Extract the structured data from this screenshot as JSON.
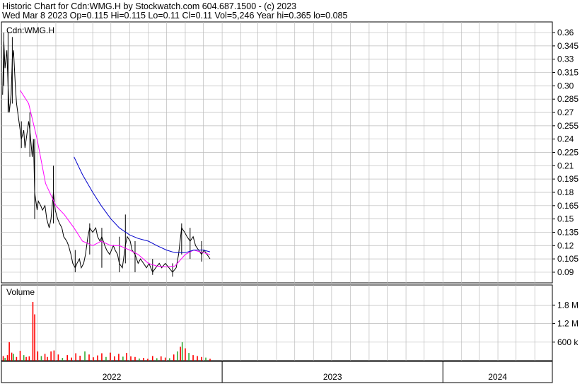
{
  "header": {
    "line1": "Historic Chart for Cdn:WMG.H by Stockwatch.com 604.687.1500 - (c) 2023",
    "line2": "Wed Mar  8 2023   Op=0.115   Hi=0.115   Lo=0.11   Cl=0.11   Vol=5,246   Year hi=0.365   lo=0.085"
  },
  "chart_data": {
    "type": "line",
    "symbol_label": "Cdn:WMG.H",
    "volume_label": "Volume",
    "price_ticks": [
      "0.36",
      "0.345",
      "0.33",
      "0.315",
      "0.30",
      "0.285",
      "0.27",
      "0.255",
      "0.24",
      "0.225",
      "0.21",
      "0.195",
      "0.18",
      "0.165",
      "0.15",
      "0.135",
      "0.12",
      "0.105",
      "0.09"
    ],
    "price_tick_values": [
      0.36,
      0.345,
      0.33,
      0.315,
      0.3,
      0.285,
      0.27,
      0.255,
      0.24,
      0.225,
      0.21,
      0.195,
      0.18,
      0.165,
      0.15,
      0.135,
      0.12,
      0.105,
      0.09
    ],
    "price_ylim": [
      0.078,
      0.372
    ],
    "volume_ticks": [
      "1.8 M",
      "1.2 M",
      "600 k"
    ],
    "volume_tick_values": [
      1800000,
      1200000,
      600000
    ],
    "volume_ylim": [
      0,
      2450000
    ],
    "x_labels": [
      "2022",
      "2023",
      "2024"
    ],
    "x_range": [
      "2022-01-01",
      "2024-06-30"
    ],
    "x_year_boundaries": [
      "2023-01-01",
      "2024-01-01"
    ],
    "grid": true,
    "colors": {
      "price": "#000000",
      "ma_fast": "#ff00ff",
      "ma_slow": "#0000cc",
      "vol_down": "#ff0000",
      "vol_up": "#33aa33",
      "grid": "#bbbbbb"
    },
    "price_path": [
      [
        "2022-01-03",
        0.29
      ],
      [
        "2022-01-05",
        0.35
      ],
      [
        "2022-01-07",
        0.32
      ],
      [
        "2022-01-10",
        0.34
      ],
      [
        "2022-01-12",
        0.3
      ],
      [
        "2022-01-14",
        0.27
      ],
      [
        "2022-01-17",
        0.29
      ],
      [
        "2022-01-19",
        0.33
      ],
      [
        "2022-01-21",
        0.34
      ],
      [
        "2022-01-24",
        0.3
      ],
      [
        "2022-01-26",
        0.28
      ],
      [
        "2022-01-28",
        0.27
      ],
      [
        "2022-02-01",
        0.25
      ],
      [
        "2022-02-03",
        0.24
      ],
      [
        "2022-02-07",
        0.25
      ],
      [
        "2022-02-09",
        0.23
      ],
      [
        "2022-02-11",
        0.24
      ],
      [
        "2022-02-15",
        0.26
      ],
      [
        "2022-02-17",
        0.25
      ],
      [
        "2022-02-21",
        0.22
      ],
      [
        "2022-02-23",
        0.24
      ],
      [
        "2022-02-25",
        0.18
      ],
      [
        "2022-03-01",
        0.16
      ],
      [
        "2022-03-03",
        0.17
      ],
      [
        "2022-03-07",
        0.165
      ],
      [
        "2022-03-10",
        0.16
      ],
      [
        "2022-03-14",
        0.165
      ],
      [
        "2022-03-17",
        0.15
      ],
      [
        "2022-03-21",
        0.14
      ],
      [
        "2022-03-24",
        0.15
      ],
      [
        "2022-03-28",
        0.18
      ],
      [
        "2022-03-31",
        0.16
      ],
      [
        "2022-04-04",
        0.15
      ],
      [
        "2022-04-07",
        0.145
      ],
      [
        "2022-04-11",
        0.14
      ],
      [
        "2022-04-14",
        0.13
      ],
      [
        "2022-04-19",
        0.125
      ],
      [
        "2022-04-22",
        0.12
      ],
      [
        "2022-04-26",
        0.11
      ],
      [
        "2022-04-29",
        0.1
      ],
      [
        "2022-05-03",
        0.095
      ],
      [
        "2022-05-06",
        0.1
      ],
      [
        "2022-05-10",
        0.105
      ],
      [
        "2022-05-13",
        0.095
      ],
      [
        "2022-05-17",
        0.1
      ],
      [
        "2022-05-20",
        0.11
      ],
      [
        "2022-05-24",
        0.13
      ],
      [
        "2022-05-27",
        0.14
      ],
      [
        "2022-06-01",
        0.135
      ],
      [
        "2022-06-06",
        0.14
      ],
      [
        "2022-06-09",
        0.13
      ],
      [
        "2022-06-13",
        0.125
      ],
      [
        "2022-06-16",
        0.13
      ],
      [
        "2022-06-21",
        0.12
      ],
      [
        "2022-06-24",
        0.115
      ],
      [
        "2022-06-29",
        0.11
      ],
      [
        "2022-07-05",
        0.12
      ],
      [
        "2022-07-08",
        0.115
      ],
      [
        "2022-07-12",
        0.11
      ],
      [
        "2022-07-15",
        0.1
      ],
      [
        "2022-07-20",
        0.095
      ],
      [
        "2022-07-25",
        0.12
      ],
      [
        "2022-07-28",
        0.13
      ],
      [
        "2022-08-02",
        0.125
      ],
      [
        "2022-08-05",
        0.115
      ],
      [
        "2022-08-10",
        0.11
      ],
      [
        "2022-08-15",
        0.1
      ],
      [
        "2022-08-19",
        0.105
      ],
      [
        "2022-08-24",
        0.1
      ],
      [
        "2022-08-29",
        0.095
      ],
      [
        "2022-09-02",
        0.1
      ],
      [
        "2022-09-08",
        0.09
      ],
      [
        "2022-09-13",
        0.095
      ],
      [
        "2022-09-19",
        0.1
      ],
      [
        "2022-09-23",
        0.095
      ],
      [
        "2022-09-29",
        0.1
      ],
      [
        "2022-10-05",
        0.095
      ],
      [
        "2022-10-11",
        0.09
      ],
      [
        "2022-10-17",
        0.095
      ],
      [
        "2022-10-21",
        0.11
      ],
      [
        "2022-10-26",
        0.14
      ],
      [
        "2022-10-31",
        0.135
      ],
      [
        "2022-11-04",
        0.13
      ],
      [
        "2022-11-09",
        0.125
      ],
      [
        "2022-11-14",
        0.13
      ],
      [
        "2022-11-18",
        0.12
      ],
      [
        "2022-11-23",
        0.115
      ],
      [
        "2022-11-28",
        0.11
      ],
      [
        "2022-12-02",
        0.115
      ],
      [
        "2022-12-07",
        0.11
      ],
      [
        "2022-12-12",
        0.105
      ]
    ],
    "price_bars": [
      [
        "2022-01-05",
        0.3,
        0.36
      ],
      [
        "2022-01-12",
        0.27,
        0.36
      ],
      [
        "2022-01-19",
        0.28,
        0.355
      ],
      [
        "2022-02-03",
        0.23,
        0.26
      ],
      [
        "2022-02-17",
        0.22,
        0.27
      ],
      [
        "2022-02-25",
        0.15,
        0.24
      ],
      [
        "2022-03-28",
        0.145,
        0.21
      ],
      [
        "2022-05-03",
        0.09,
        0.115
      ],
      [
        "2022-05-27",
        0.11,
        0.145
      ],
      [
        "2022-06-16",
        0.095,
        0.14
      ],
      [
        "2022-07-15",
        0.09,
        0.13
      ],
      [
        "2022-07-25",
        0.1,
        0.155
      ],
      [
        "2022-08-10",
        0.09,
        0.125
      ],
      [
        "2022-09-08",
        0.087,
        0.105
      ],
      [
        "2022-10-11",
        0.085,
        0.1
      ],
      [
        "2022-10-26",
        0.11,
        0.145
      ],
      [
        "2022-11-09",
        0.105,
        0.14
      ],
      [
        "2022-11-28",
        0.102,
        0.125
      ]
    ],
    "series": [
      {
        "values": [
          [
            "2022-02-01",
            0.295
          ],
          [
            "2022-02-15",
            0.28
          ],
          [
            "2022-03-01",
            0.24
          ],
          [
            "2022-03-15",
            0.19
          ],
          [
            "2022-04-01",
            0.165
          ],
          [
            "2022-04-15",
            0.155
          ],
          [
            "2022-05-01",
            0.14
          ],
          [
            "2022-05-15",
            0.125
          ],
          [
            "2022-06-01",
            0.12
          ],
          [
            "2022-06-15",
            0.125
          ],
          [
            "2022-07-01",
            0.12
          ],
          [
            "2022-07-15",
            0.12
          ],
          [
            "2022-08-01",
            0.115
          ],
          [
            "2022-08-15",
            0.11
          ],
          [
            "2022-09-01",
            0.1
          ],
          [
            "2022-09-15",
            0.097
          ],
          [
            "2022-10-01",
            0.096
          ],
          [
            "2022-10-15",
            0.097
          ],
          [
            "2022-11-01",
            0.11
          ],
          [
            "2022-11-15",
            0.115
          ],
          [
            "2022-12-01",
            0.112
          ],
          [
            "2022-12-12",
            0.11
          ]
        ]
      },
      {
        "values": [
          [
            "2022-05-01",
            0.22
          ],
          [
            "2022-05-15",
            0.2
          ],
          [
            "2022-06-01",
            0.18
          ],
          [
            "2022-06-15",
            0.165
          ],
          [
            "2022-07-01",
            0.15
          ],
          [
            "2022-07-15",
            0.14
          ],
          [
            "2022-08-01",
            0.132
          ],
          [
            "2022-08-15",
            0.128
          ],
          [
            "2022-09-01",
            0.125
          ],
          [
            "2022-09-15",
            0.12
          ],
          [
            "2022-10-01",
            0.115
          ],
          [
            "2022-10-15",
            0.112
          ],
          [
            "2022-11-01",
            0.112
          ],
          [
            "2022-11-15",
            0.115
          ],
          [
            "2022-12-01",
            0.115
          ],
          [
            "2022-12-12",
            0.113
          ]
        ]
      }
    ],
    "volume": [
      [
        "2022-01-04",
        150000,
        "down"
      ],
      [
        "2022-01-07",
        90000,
        "up"
      ],
      [
        "2022-01-11",
        180000,
        "down"
      ],
      [
        "2022-01-14",
        600000,
        "down"
      ],
      [
        "2022-01-18",
        260000,
        "down"
      ],
      [
        "2022-01-21",
        220000,
        "up"
      ],
      [
        "2022-01-26",
        120000,
        "down"
      ],
      [
        "2022-02-01",
        320000,
        "down"
      ],
      [
        "2022-02-07",
        180000,
        "up"
      ],
      [
        "2022-02-11",
        120000,
        "down"
      ],
      [
        "2022-02-16",
        140000,
        "down"
      ],
      [
        "2022-02-22",
        1900000,
        "down"
      ],
      [
        "2022-02-25",
        1500000,
        "down"
      ],
      [
        "2022-03-02",
        300000,
        "down"
      ],
      [
        "2022-03-08",
        150000,
        "up"
      ],
      [
        "2022-03-14",
        220000,
        "down"
      ],
      [
        "2022-03-18",
        120000,
        "down"
      ],
      [
        "2022-03-24",
        300000,
        "down"
      ],
      [
        "2022-03-29",
        330000,
        "down"
      ],
      [
        "2022-04-05",
        200000,
        "down"
      ],
      [
        "2022-04-12",
        90000,
        "up"
      ],
      [
        "2022-04-20",
        180000,
        "down"
      ],
      [
        "2022-04-27",
        100000,
        "down"
      ],
      [
        "2022-05-04",
        240000,
        "down"
      ],
      [
        "2022-05-11",
        160000,
        "down"
      ],
      [
        "2022-05-19",
        300000,
        "up"
      ],
      [
        "2022-05-26",
        200000,
        "down"
      ],
      [
        "2022-06-02",
        110000,
        "down"
      ],
      [
        "2022-06-09",
        170000,
        "down"
      ],
      [
        "2022-06-16",
        240000,
        "down"
      ],
      [
        "2022-06-23",
        120000,
        "up"
      ],
      [
        "2022-06-30",
        260000,
        "down"
      ],
      [
        "2022-07-07",
        140000,
        "down"
      ],
      [
        "2022-07-14",
        220000,
        "down"
      ],
      [
        "2022-07-21",
        130000,
        "up"
      ],
      [
        "2022-07-27",
        250000,
        "down"
      ],
      [
        "2022-08-03",
        140000,
        "down"
      ],
      [
        "2022-08-10",
        120000,
        "down"
      ],
      [
        "2022-08-17",
        70000,
        "up"
      ],
      [
        "2022-08-24",
        90000,
        "down"
      ],
      [
        "2022-08-31",
        60000,
        "down"
      ],
      [
        "2022-09-08",
        150000,
        "down"
      ],
      [
        "2022-09-15",
        80000,
        "up"
      ],
      [
        "2022-09-22",
        140000,
        "down"
      ],
      [
        "2022-09-29",
        100000,
        "down"
      ],
      [
        "2022-10-06",
        80000,
        "up"
      ],
      [
        "2022-10-13",
        200000,
        "down"
      ],
      [
        "2022-10-19",
        300000,
        "up"
      ],
      [
        "2022-10-24",
        450000,
        "down"
      ],
      [
        "2022-10-27",
        600000,
        "up"
      ],
      [
        "2022-11-01",
        400000,
        "down"
      ],
      [
        "2022-11-07",
        250000,
        "up"
      ],
      [
        "2022-11-14",
        180000,
        "down"
      ],
      [
        "2022-11-21",
        150000,
        "down"
      ],
      [
        "2022-11-28",
        120000,
        "down"
      ],
      [
        "2022-12-05",
        100000,
        "up"
      ],
      [
        "2022-12-12",
        60000,
        "down"
      ]
    ]
  }
}
